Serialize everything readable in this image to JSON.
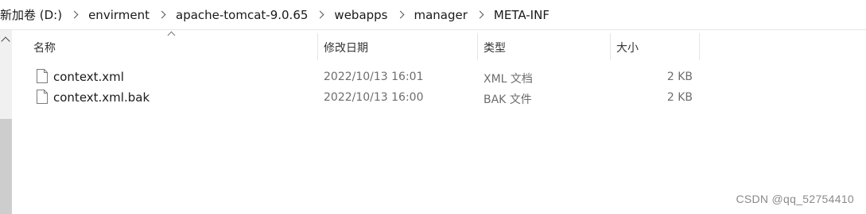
{
  "breadcrumb": [
    "新加卷 (D:)",
    "envirment",
    "apache-tomcat-9.0.65",
    "webapps",
    "manager",
    "META-INF"
  ],
  "columns": {
    "name": "名称",
    "date": "修改日期",
    "type": "类型",
    "size": "大小"
  },
  "files": [
    {
      "name": "context.xml",
      "date": "2022/10/13 16:01",
      "type": "XML 文档",
      "size": "2 KB"
    },
    {
      "name": "context.xml.bak",
      "date": "2022/10/13 16:00",
      "type": "BAK 文件",
      "size": "2 KB"
    }
  ],
  "watermark": "CSDN @qq_52754410"
}
